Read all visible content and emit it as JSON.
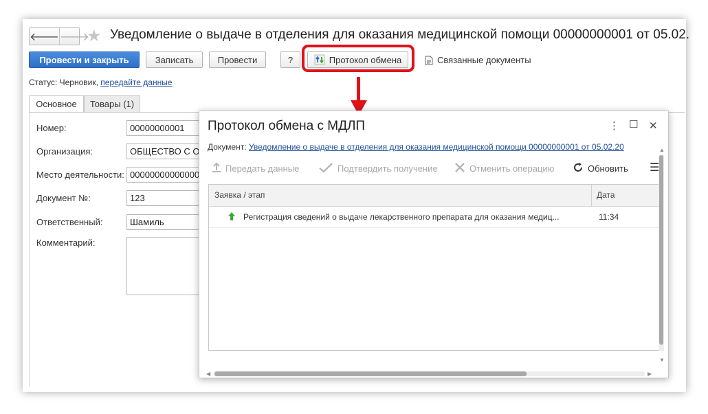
{
  "window": {
    "title": "Уведомление о выдаче в отделения для оказания медицинской помощи 00000000001 от 05.02.",
    "nav_back": "🡐",
    "nav_forward": "🡒",
    "star_icon": "★"
  },
  "toolbar": {
    "post_and_close": "Провести и закрыть",
    "save": "Записать",
    "post": "Провести",
    "help": "?",
    "exchange_log": "Протокол обмена",
    "related_docs": "Связанные документы"
  },
  "status": {
    "label": "Статус:",
    "value": "Черновик,",
    "link": "передайте данные"
  },
  "tabs": [
    {
      "label": "Основное",
      "active": true
    },
    {
      "label": "Товары (1)",
      "active": false
    }
  ],
  "form": {
    "number_label": "Номер:",
    "number_value": "00000000001",
    "org_label": "Организация:",
    "org_value": "ОБЩЕСТВО С О",
    "place_label": "Место деятельности:",
    "place_value": "00000000000000",
    "doc_no_label": "Документ №:",
    "doc_no_value": "123",
    "responsible_label": "Ответственный:",
    "responsible_value": "Шамиль",
    "comment_label": "Комментарий:",
    "comment_value": ""
  },
  "dialog": {
    "title": "Протокол обмена с МДЛП",
    "menu_icon": "⋮",
    "maximize_icon": "☐",
    "close_icon": "✕",
    "doc_label": "Документ:",
    "doc_link": "Уведомление о выдаче в отделения для оказания медицинской помощи 00000000001 от 05.02.20",
    "toolbar": {
      "send": "Передать данные",
      "confirm": "Подтвердить получение",
      "cancel": "Отменить операцию",
      "refresh": "Обновить",
      "more_icon": "☰"
    },
    "grid": {
      "columns": [
        "Заявка / этап",
        "Дата"
      ],
      "rows": [
        {
          "stage": "Регистрация сведений о выдаче лекарственного препарата для оказания медиц...",
          "date": "11:34"
        }
      ]
    }
  },
  "colors": {
    "primary_button": "#2f6ec4",
    "highlight": "#e0121a",
    "link": "#1f4e99",
    "arrow_up_green": "#3aa935"
  }
}
